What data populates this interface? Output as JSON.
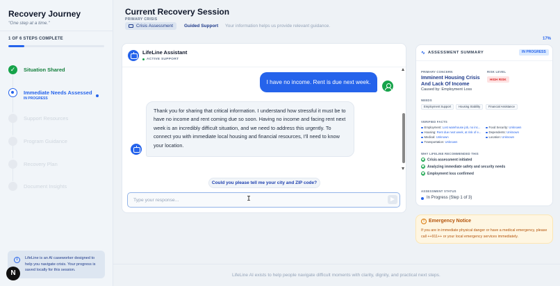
{
  "sidebar": {
    "title": "Recovery Journey",
    "subtitle": "\"One step at a time.\"",
    "progress_label": "1 OF 6 STEPS COMPLETE",
    "progress_pct": "17%",
    "progress_fraction": 0.17,
    "steps": [
      {
        "label": "Situation Shared",
        "state": "complete",
        "icon": "check-icon"
      },
      {
        "label": "Immediate Needs Assessed",
        "state": "active",
        "sub": "IN PROGRESS"
      },
      {
        "label": "Support Resources",
        "state": "pending"
      },
      {
        "label": "Program Guidance",
        "state": "pending"
      },
      {
        "label": "Recovery Plan",
        "state": "pending"
      },
      {
        "label": "Document Insights",
        "state": "pending"
      }
    ],
    "info_text": "LifeLine is an AI caseworker designed to help you navigate crisis. Your progress is saved locally for this session.",
    "badge": "N"
  },
  "header": {
    "title": "Current Recovery Session",
    "primary_label": "PRIMARY CRISIS",
    "chip": "Crisis Assessment",
    "guided": "Guided Support",
    "info": "Your information helps us provide relevant guidance."
  },
  "chat": {
    "name": "LifeLine Assistant",
    "status": "ACTIVE SUPPORT",
    "user_message": "I have no income. Rent is due next week.",
    "bot_message": "Thank you for sharing that critical information. I understand how stressful it must be to have no income and rent coming due so soon. Having no income and facing rent next week is an incredibly difficult situation, and we need to address this urgently. To connect you with immediate local housing and financial resources, I'll need to know your location.",
    "suggestion": "Could you please tell me your city and ZIP code?",
    "input_placeholder": "Type your response..."
  },
  "assessment": {
    "title": "ASSESSMENT SUMMARY",
    "badge": "IN PROGRESS",
    "primary_concern_label": "PRIMARY CONCERN",
    "primary_concern": "Imminent Housing Crisis And Lack Of Income",
    "caused_by": "Caused by: Employment Loss",
    "risk_label": "RISK LEVEL",
    "risk": "HIGH RISK",
    "needs_label": "NEEDS",
    "needs": [
      "Employment Support",
      "Housing Stability",
      "Financial Assistance"
    ],
    "facts_label": "VERIFIED FACTS",
    "facts_left": [
      {
        "k": "Employment:",
        "v": "Lost warehouse job, no inc..."
      },
      {
        "k": "Housing:",
        "v": "Rent due next week, at risk of e..."
      },
      {
        "k": "Medical:",
        "v": "Unknown"
      },
      {
        "k": "Transportation:",
        "v": "Unknown"
      }
    ],
    "facts_right": [
      {
        "k": "Food Security:",
        "v": "Unknown"
      },
      {
        "k": "Dependents:",
        "v": "Unknown"
      },
      {
        "k": "Location:",
        "v": "Unknown"
      }
    ],
    "why_label": "WHY LIFELINE RECOMMENDED THIS",
    "why": [
      "Crisis assessment initiated",
      "Analyzing immediate safety and security needs",
      "Employment loss confirmed"
    ],
    "status_label": "ASSESSMENT STATUS",
    "status": "In Progress (Step 1 of 3)"
  },
  "emergency": {
    "title": "Emergency Notice",
    "text": "If you are in immediate physical danger or have a medical emergency, please call ++911++ or your local emergency services immediately."
  },
  "footer": {
    "text": "LifeLine AI exists to help people navigate difficult moments with clarity, dignity, and practical next steps."
  }
}
